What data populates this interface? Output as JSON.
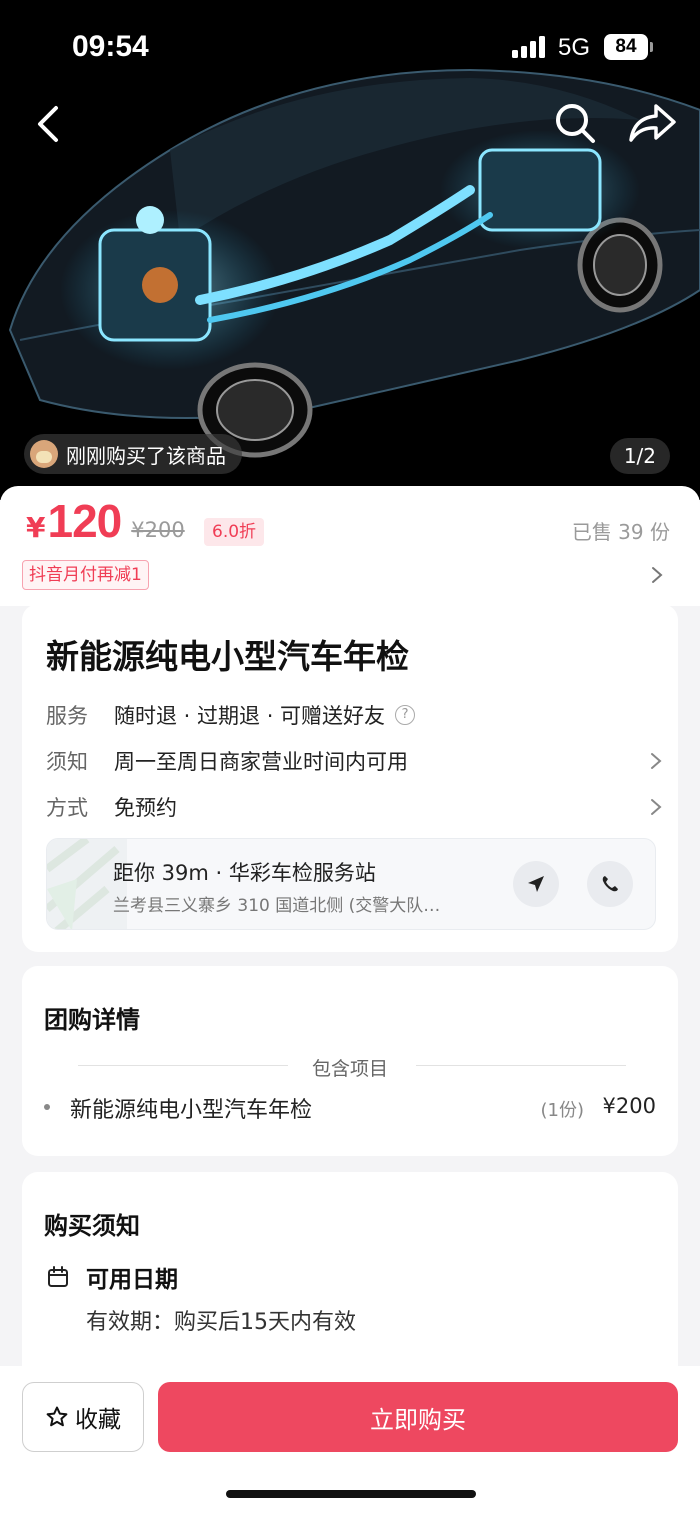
{
  "status_bar": {
    "time": "09:54",
    "network": "5G",
    "battery": "84"
  },
  "hero": {
    "buyer_notice": "刚刚购买了该商品",
    "image_counter": "1/2"
  },
  "icons": {
    "back": "chevron-left-icon",
    "search": "search-icon",
    "share": "share-icon",
    "help": "question-icon",
    "navigate": "navigation-arrow-icon",
    "phone": "phone-icon",
    "calendar": "calendar-icon",
    "favorite": "star-icon"
  },
  "price": {
    "currency": "¥",
    "current": "120",
    "original": "¥200",
    "discount": "6.0折",
    "sold": "已售 39 份",
    "promo": "抖音月付再减1"
  },
  "product": {
    "title": "新能源纯电小型汽车年检",
    "rows": [
      {
        "key": "服务",
        "value": "随时退 · 过期退 · 可赠送好友"
      },
      {
        "key": "须知",
        "value": "周一至周日商家营业时间内可用"
      },
      {
        "key": "方式",
        "value": "免预约"
      }
    ]
  },
  "store": {
    "name": "距你 39m · 华彩车检服务站",
    "address": "兰考县三义寨乡 310 国道北侧 (交警大队…"
  },
  "deal": {
    "title": "团购详情",
    "section_label": "包含项目",
    "items": [
      {
        "name": "新能源纯电小型汽车年检",
        "qty": "(1份)",
        "price": "¥200"
      }
    ]
  },
  "notice": {
    "title": "购买须知",
    "subtitle": "可用日期",
    "text": "有效期：购买后15天内有效"
  },
  "bottom_bar": {
    "favorite_label": "收藏",
    "buy_label": "立即购买"
  },
  "colors": {
    "accent": "#f03d55",
    "buy_button": "#ee4860",
    "hero_bg": "#000000"
  }
}
